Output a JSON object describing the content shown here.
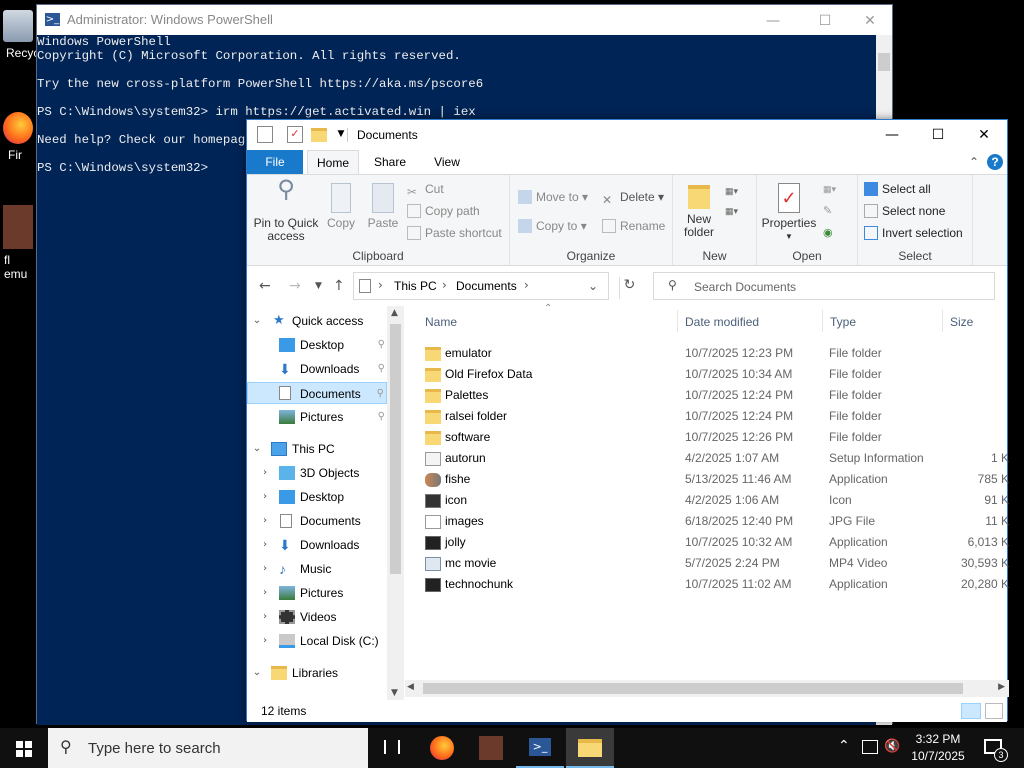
{
  "desktop": {
    "icons": [
      {
        "label": "Recyc",
        "icon": "recycle-bin-icon"
      },
      {
        "label": "Fir",
        "icon": "firefox-icon"
      },
      {
        "label": "fl\nemu",
        "icon": "flash-emulator-icon"
      }
    ]
  },
  "powershell": {
    "title": "Administrator: Windows PowerShell",
    "lines": [
      "Windows PowerShell",
      "Copyright (C) Microsoft Corporation. All rights reserved.",
      "",
      "Try the new cross-platform PowerShell https://aka.ms/pscore6",
      "",
      "PS C:\\Windows\\system32> irm https://get.activated.win | iex",
      "",
      "Need help? Check our homepage: ",
      "",
      "PS C:\\Windows\\system32>"
    ],
    "bg_color": "#012456"
  },
  "explorer": {
    "title": "Documents",
    "tabs": [
      "File",
      "Home",
      "Share",
      "View"
    ],
    "ribbon": {
      "clipboard": {
        "label": "Clipboard",
        "pin": "Pin to Quick\naccess",
        "copy": "Copy",
        "paste": "Paste",
        "cut": "Cut",
        "copy_path": "Copy path",
        "paste_shortcut": "Paste shortcut"
      },
      "organize": {
        "label": "Organize",
        "move_to": "Move to",
        "copy_to": "Copy to",
        "delete": "Delete",
        "rename": "Rename"
      },
      "new": {
        "label": "New",
        "new_folder": "New\nfolder"
      },
      "open": {
        "label": "Open",
        "properties": "Properties"
      },
      "select": {
        "label": "Select",
        "select_all": "Select all",
        "select_none": "Select none",
        "invert": "Invert selection"
      }
    },
    "address": {
      "crumbs": [
        "This PC",
        "Documents"
      ]
    },
    "search_placeholder": "Search Documents",
    "nav": {
      "quick_access": "Quick access",
      "quick_items": [
        "Desktop",
        "Downloads",
        "Documents",
        "Pictures"
      ],
      "this_pc": "This PC",
      "pc_items": [
        "3D Objects",
        "Desktop",
        "Documents",
        "Downloads",
        "Music",
        "Pictures",
        "Videos",
        "Local Disk (C:)"
      ],
      "libraries": "Libraries"
    },
    "columns": {
      "name": "Name",
      "date": "Date modified",
      "type": "Type",
      "size": "Size"
    },
    "files": [
      {
        "name": "emulator",
        "date": "10/7/2025 12:23 PM",
        "type": "File folder",
        "size": "",
        "icon": "folder-icon"
      },
      {
        "name": "Old Firefox Data",
        "date": "10/7/2025 10:34 AM",
        "type": "File folder",
        "size": "",
        "icon": "folder-icon"
      },
      {
        "name": "Palettes",
        "date": "10/7/2025 12:24 PM",
        "type": "File folder",
        "size": "",
        "icon": "folder-icon"
      },
      {
        "name": "ralsei folder",
        "date": "10/7/2025 12:24 PM",
        "type": "File folder",
        "size": "",
        "icon": "folder-icon"
      },
      {
        "name": "software",
        "date": "10/7/2025 12:26 PM",
        "type": "File folder",
        "size": "",
        "icon": "folder-icon"
      },
      {
        "name": "autorun",
        "date": "4/2/2025 1:07 AM",
        "type": "Setup Information",
        "size": "1 K",
        "icon": "setup-file-icon"
      },
      {
        "name": "fishe",
        "date": "5/13/2025 11:46 AM",
        "type": "Application",
        "size": "785 K",
        "icon": "fish-app-icon"
      },
      {
        "name": "icon",
        "date": "4/2/2025 1:06 AM",
        "type": "Icon",
        "size": "91 K",
        "icon": "ico-file-icon"
      },
      {
        "name": "images",
        "date": "6/18/2025 12:40 PM",
        "type": "JPG File",
        "size": "11 K",
        "icon": "jpg-file-icon"
      },
      {
        "name": "jolly",
        "date": "10/7/2025 10:32 AM",
        "type": "Application",
        "size": "6,013 K",
        "icon": "app-icon"
      },
      {
        "name": "mc movie",
        "date": "5/7/2025 2:24 PM",
        "type": "MP4 Video",
        "size": "30,593 K",
        "icon": "video-file-icon"
      },
      {
        "name": "technochunk",
        "date": "10/7/2025 11:02 AM",
        "type": "Application",
        "size": "20,280 K",
        "icon": "app-icon"
      }
    ],
    "status": "12 items"
  },
  "taskbar": {
    "search_placeholder": "Type here to search",
    "time": "3:32 PM",
    "date": "10/7/2025",
    "notification_count": "3"
  }
}
